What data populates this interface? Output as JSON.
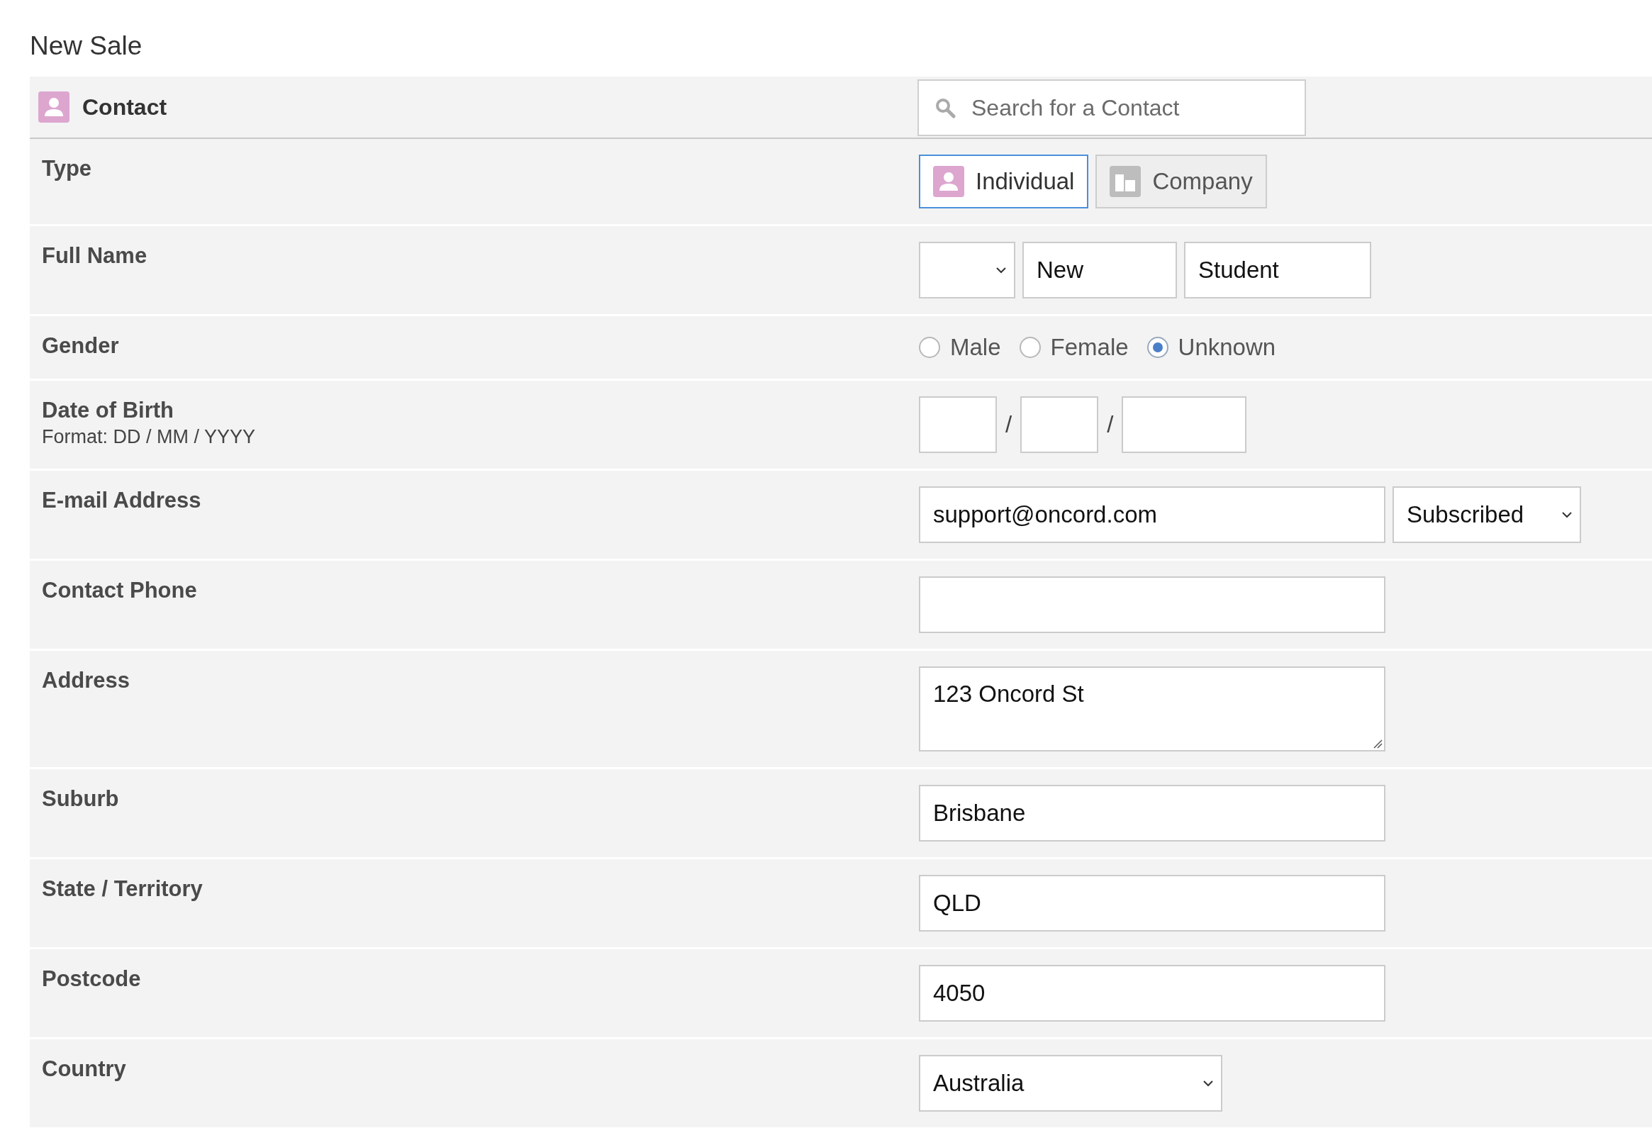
{
  "page_title": "New Sale",
  "section": {
    "title": "Contact",
    "search": {
      "placeholder": "Search for a Contact"
    }
  },
  "fields": [
    {
      "kind": "type",
      "label": "Type",
      "options": [
        {
          "label": "Individual",
          "kind": "person",
          "selected": true
        },
        {
          "label": "Company",
          "kind": "building",
          "selected": false
        }
      ]
    },
    {
      "kind": "name",
      "label": "Full Name",
      "parts": [
        "New",
        "Student"
      ]
    },
    {
      "kind": "radio",
      "label": "Gender",
      "options": [
        {
          "label": "Male",
          "selected": false
        },
        {
          "label": "Female",
          "selected": false
        },
        {
          "label": "Unknown",
          "selected": true
        }
      ]
    },
    {
      "kind": "date",
      "label": "Date of Birth",
      "hint": "Format: DD / MM / YYYY",
      "separators": [
        "/",
        "/"
      ]
    },
    {
      "kind": "email",
      "label": "E-mail Address",
      "value": "support@oncord.com",
      "status": "Subscribed"
    },
    {
      "kind": "text",
      "label": "Contact Phone"
    },
    {
      "kind": "textarea",
      "label": "Address",
      "value": "123 Oncord St"
    },
    {
      "kind": "text",
      "label": "Suburb",
      "value": "Brisbane"
    },
    {
      "kind": "text",
      "label": "State / Territory",
      "value": "QLD"
    },
    {
      "kind": "text",
      "label": "Postcode",
      "value": "4050"
    },
    {
      "kind": "select",
      "label": "Country",
      "value": "Australia"
    }
  ]
}
